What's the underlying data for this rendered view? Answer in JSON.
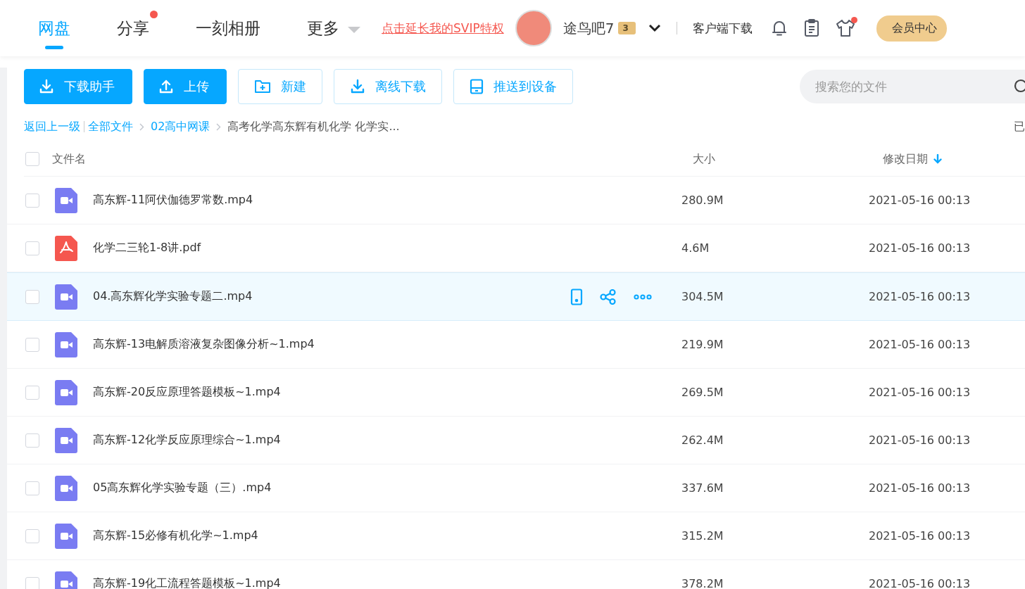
{
  "nav": {
    "tabs": [
      {
        "label": "网盘",
        "selected": true,
        "dot": false
      },
      {
        "label": "分享",
        "selected": false,
        "dot": true
      },
      {
        "label": "一刻相册",
        "selected": false,
        "dot": false
      },
      {
        "label": "更多",
        "selected": false,
        "dot": false
      }
    ],
    "promo_link": "点击延长我的SVIP特权",
    "user": {
      "name": "途鸟吧7",
      "level": "3"
    },
    "client_download": "客户端下载",
    "icons": [
      {
        "kind": "bell",
        "dot": false
      },
      {
        "kind": "clipboard",
        "dot": false
      },
      {
        "kind": "shirt",
        "dot": true
      }
    ],
    "member_button": "会员中心"
  },
  "toolbar": {
    "buttons": [
      {
        "label": "下载助手",
        "kind": "download",
        "primary": true
      },
      {
        "label": "上传",
        "kind": "upload",
        "primary": true
      },
      {
        "label": "新建",
        "kind": "folder",
        "primary": false
      },
      {
        "label": "离线下载",
        "kind": "download",
        "primary": false
      },
      {
        "label": "推送到设备",
        "kind": "device",
        "primary": false
      }
    ],
    "search": {
      "placeholder": "搜索您的文件"
    }
  },
  "breadcrumb": {
    "back": "返回上一级",
    "items": [
      "全部文件",
      "02高中网课"
    ],
    "current": "高考化学高东辉有机化学 化学实...",
    "right_text": "已"
  },
  "table": {
    "select_all_checked": false,
    "columns": [
      "文件名",
      "大小",
      "修改日期"
    ],
    "rows": [
      {
        "kind": "video",
        "name": "高东辉-11阿伏伽德罗常数.mp4",
        "size": "280.9M",
        "date": "2021-05-16 00:13",
        "checked": false,
        "hovered": false
      },
      {
        "kind": "pdf",
        "name": "化学二三轮1-8讲.pdf",
        "size": "4.6M",
        "date": "2021-05-16 00:13",
        "checked": false,
        "hovered": false
      },
      {
        "kind": "video",
        "name": "04.高东辉化学实验专题二.mp4",
        "size": "304.5M",
        "date": "2021-05-16 00:13",
        "checked": false,
        "hovered": true
      },
      {
        "kind": "video",
        "name": "高东辉-13电解质溶液复杂图像分析~1.mp4",
        "size": "219.9M",
        "date": "2021-05-16 00:13",
        "checked": false,
        "hovered": false
      },
      {
        "kind": "video",
        "name": "高东辉-20反应原理答题模板~1.mp4",
        "size": "269.5M",
        "date": "2021-05-16 00:13",
        "checked": false,
        "hovered": false
      },
      {
        "kind": "video",
        "name": "高东辉-12化学反应原理综合~1.mp4",
        "size": "262.4M",
        "date": "2021-05-16 00:13",
        "checked": false,
        "hovered": false
      },
      {
        "kind": "video",
        "name": "05高东辉化学实验专题（三）.mp4",
        "size": "337.6M",
        "date": "2021-05-16 00:13",
        "checked": false,
        "hovered": false
      },
      {
        "kind": "video",
        "name": "高东辉-15必修有机化学~1.mp4",
        "size": "315.2M",
        "date": "2021-05-16 00:13",
        "checked": false,
        "hovered": false
      },
      {
        "kind": "video",
        "name": "高东辉-19化工流程答题模板~1.mp4",
        "size": "378.2M",
        "date": "2021-05-16 00:13",
        "checked": false,
        "hovered": false
      }
    ]
  }
}
